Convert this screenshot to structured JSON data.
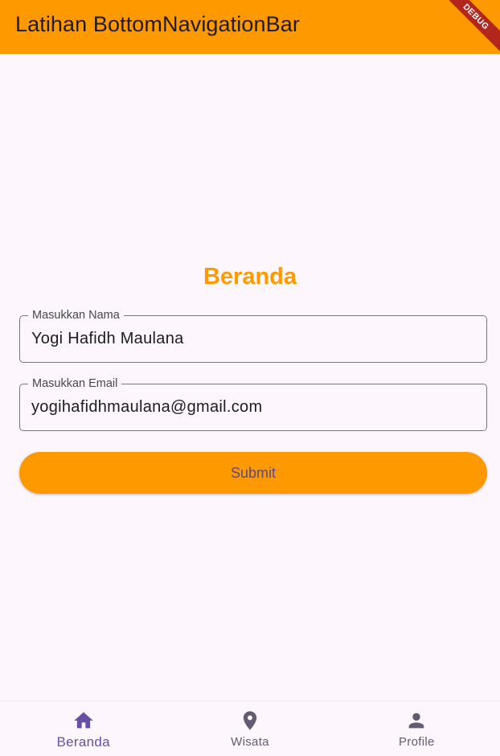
{
  "appbar": {
    "title": "Latihan BottomNavigationBar",
    "debug_banner": "DEBUG"
  },
  "main": {
    "heading": "Beranda",
    "fields": [
      {
        "label": "Masukkan Nama",
        "value": "Yogi Hafidh Maulana"
      },
      {
        "label": "Masukkan Email",
        "value": "yogihafidhmaulana@gmail.com"
      }
    ],
    "submit_label": "Submit"
  },
  "bottom_nav": {
    "items": [
      {
        "label": "Beranda",
        "icon": "home-icon",
        "active": true
      },
      {
        "label": "Wisata",
        "icon": "location-pin-icon",
        "active": false
      },
      {
        "label": "Profile",
        "icon": "person-icon",
        "active": false
      }
    ]
  },
  "colors": {
    "primary": "#ff9900",
    "nav_active": "#6750a4",
    "nav_inactive": "#625b71",
    "background": "#fdf7fd"
  }
}
